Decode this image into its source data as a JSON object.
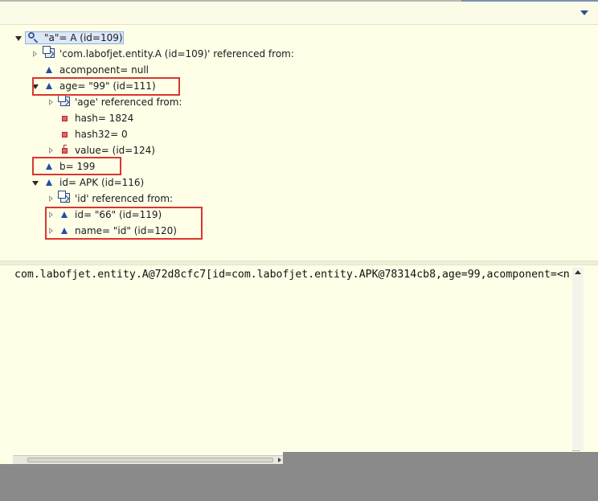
{
  "tree": {
    "rows": [
      {
        "label": "\"a\"= A  (id=109)"
      },
      {
        "label": "'com.labofjet.entity.A  (id=109)' referenced from:"
      },
      {
        "label": "acomponent= null"
      },
      {
        "label": "age= \"99\" (id=111)"
      },
      {
        "label": "'age' referenced from:"
      },
      {
        "label": "hash= 1824"
      },
      {
        "label": "hash32= 0"
      },
      {
        "label": "value= (id=124)"
      },
      {
        "label": "b= 199"
      },
      {
        "label": "id= APK  (id=116)"
      },
      {
        "label": "'id' referenced from:"
      },
      {
        "label": "id= \"66\" (id=119)"
      },
      {
        "label": "name= \"id\" (id=120)"
      }
    ]
  },
  "detail": {
    "text": "com.labofjet.entity.A@72d8cfc7[id=com.labofjet.entity.APK@78314cb8,age=99,acomponent=<n"
  },
  "icons": {
    "menu": "chevron-down-icon",
    "root": "search-icon",
    "reference": "reference-icon",
    "field_object": "blue-triangle-field-icon",
    "field_primitive": "red-square-field-icon",
    "field_array": "red-square-array-icon"
  },
  "colors": {
    "background": "#ffffe8",
    "highlight_box": "#d9362e",
    "selection": "#dde7f7",
    "field_icon": "#1f4fa8",
    "primitive_icon": "#e86060"
  }
}
